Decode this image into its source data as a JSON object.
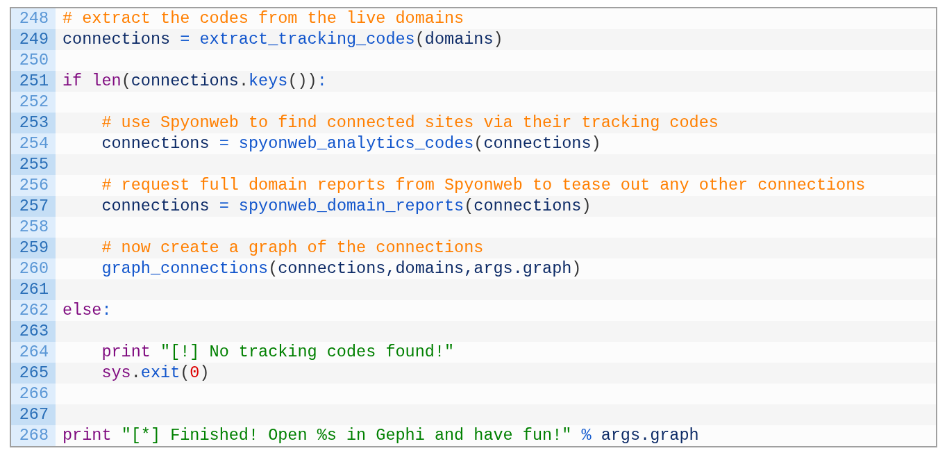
{
  "code": {
    "lines": [
      {
        "number": "248",
        "tokens": [
          {
            "kind": "comment",
            "text": "# extract the codes from the live domains"
          }
        ]
      },
      {
        "number": "249",
        "tokens": [
          {
            "kind": "name",
            "text": "connections "
          },
          {
            "kind": "op",
            "text": "= "
          },
          {
            "kind": "func",
            "text": "extract_tracking_codes"
          },
          {
            "kind": "punct",
            "text": "("
          },
          {
            "kind": "name",
            "text": "domains"
          },
          {
            "kind": "punct",
            "text": ")"
          }
        ]
      },
      {
        "number": "250"
      },
      {
        "number": "251",
        "tokens": [
          {
            "kind": "keyword",
            "text": "if len"
          },
          {
            "kind": "punct",
            "text": "("
          },
          {
            "kind": "name",
            "text": "connections"
          },
          {
            "kind": "punct",
            "text": "."
          },
          {
            "kind": "func",
            "text": "keys"
          },
          {
            "kind": "punct",
            "text": "())"
          },
          {
            "kind": "op",
            "text": ":"
          }
        ]
      },
      {
        "number": "252"
      },
      {
        "number": "253",
        "tokens": [
          {
            "kind": "comment",
            "text": "    # use Spyonweb to find connected sites via their tracking codes"
          }
        ]
      },
      {
        "number": "254",
        "tokens": [
          {
            "kind": "name",
            "text": "    connections "
          },
          {
            "kind": "op",
            "text": "= "
          },
          {
            "kind": "func",
            "text": "spyonweb_analytics_codes"
          },
          {
            "kind": "punct",
            "text": "("
          },
          {
            "kind": "name",
            "text": "connections"
          },
          {
            "kind": "punct",
            "text": ")"
          }
        ]
      },
      {
        "number": "255"
      },
      {
        "number": "256",
        "tokens": [
          {
            "kind": "comment",
            "text": "    # request full domain reports from Spyonweb to tease out any other connections"
          }
        ]
      },
      {
        "number": "257",
        "tokens": [
          {
            "kind": "name",
            "text": "    connections "
          },
          {
            "kind": "op",
            "text": "= "
          },
          {
            "kind": "func",
            "text": "spyonweb_domain_reports"
          },
          {
            "kind": "punct",
            "text": "("
          },
          {
            "kind": "name",
            "text": "connections"
          },
          {
            "kind": "punct",
            "text": ")"
          }
        ]
      },
      {
        "number": "258"
      },
      {
        "number": "259",
        "tokens": [
          {
            "kind": "comment",
            "text": "    # now create a graph of the connections"
          }
        ]
      },
      {
        "number": "260",
        "tokens": [
          {
            "kind": "func",
            "text": "    graph_connections"
          },
          {
            "kind": "punct",
            "text": "("
          },
          {
            "kind": "name",
            "text": "connections,domains,args.graph"
          },
          {
            "kind": "punct",
            "text": ")"
          }
        ]
      },
      {
        "number": "261"
      },
      {
        "number": "262",
        "tokens": [
          {
            "kind": "keyword",
            "text": "else"
          },
          {
            "kind": "op",
            "text": ":"
          }
        ]
      },
      {
        "number": "263"
      },
      {
        "number": "264",
        "tokens": [
          {
            "kind": "keyword",
            "text": "    print "
          },
          {
            "kind": "string",
            "text": "\"[!] No tracking codes found!\""
          }
        ]
      },
      {
        "number": "265",
        "tokens": [
          {
            "kind": "keyword",
            "text": "    sys"
          },
          {
            "kind": "punct",
            "text": "."
          },
          {
            "kind": "func",
            "text": "exit"
          },
          {
            "kind": "punct",
            "text": "("
          },
          {
            "kind": "number",
            "text": "0"
          },
          {
            "kind": "punct",
            "text": ")"
          }
        ]
      },
      {
        "number": "266"
      },
      {
        "number": "267"
      },
      {
        "number": "268",
        "tokens": [
          {
            "kind": "keyword",
            "text": "print "
          },
          {
            "kind": "string",
            "text": "\"[*] Finished! Open %s in Gephi and have fun!\" "
          },
          {
            "kind": "op",
            "text": "%"
          },
          {
            "kind": "name",
            "text": " args.graph"
          }
        ]
      }
    ]
  }
}
